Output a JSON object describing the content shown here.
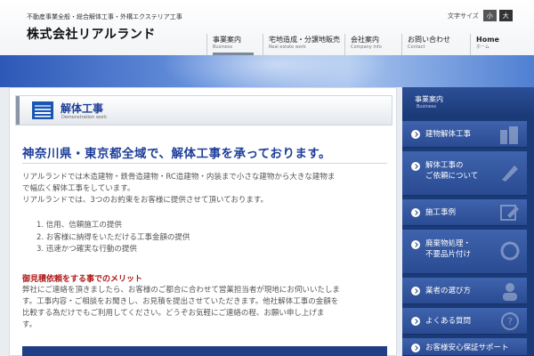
{
  "header": {
    "tagline": "不動産事業全般・総合解体工事・外構エクステリア工事",
    "logo": "株式会社リアルランド",
    "font_size": {
      "label": "文字サイズ",
      "small": "小",
      "large": "大"
    }
  },
  "nav": [
    {
      "jp": "事業案内",
      "en": "Business"
    },
    {
      "jp": "宅地造成・分譲地販売",
      "en": "Real estate work"
    },
    {
      "jp": "会社案内",
      "en": "Company info"
    },
    {
      "jp": "お問い合わせ",
      "en": "Contact"
    },
    {
      "jp": "Home",
      "en": "ホーム"
    }
  ],
  "main": {
    "title": "解体工事",
    "title_sub": "Demonstration work",
    "headline": "神奈川県・東京都全域で、解体工事を承っております。",
    "intro": [
      "リアルランドでは木造建物・鉄骨造建物・RC造建物・内装まで小さな建物から大きな建物ま",
      "で幅広く解体工事をしています。",
      "リアルランドでは、3つのお約束をお客様に提供させて頂いております。"
    ],
    "promises": [
      "1. 信用、信頼施工の提供",
      "2. お客様に納得をいただける工事金額の提供",
      "3. 迅速かつ確実な行動の提供"
    ],
    "merit_title": "御見積依頼をする事でのメリット",
    "merit_body": [
      "弊社にご連絡を頂きましたら、お客様のご都合に合わせて営業担当者が現地にお伺いいたしま",
      "す。工事内容・ご相談をお聞きし、お見積を提出させていただきます。他社解体工事の金額を",
      "比較する為だけでもご利用してください。どうぞお気軽にご連絡の程、お願い申し上げま",
      "す。"
    ]
  },
  "sidebar": {
    "head_jp": "事業案内",
    "head_en": "Business",
    "items": [
      {
        "lines": [
          "建物解体工事"
        ]
      },
      {
        "lines": [
          "解体工事の",
          "ご依頼について"
        ]
      },
      {
        "lines": [
          "施工事例"
        ]
      },
      {
        "lines": [
          "廃棄物処理・",
          "不要品片付け"
        ]
      },
      {
        "lines": [
          "業者の選び方"
        ]
      },
      {
        "lines": [
          "よくある質問"
        ]
      },
      {
        "lines": [
          "お客様安心保証サポート"
        ]
      }
    ]
  },
  "colors": {
    "accent_blue": "#1e3f9a",
    "sidebar_navy": "#1b3a78",
    "merit_red": "#b01818"
  }
}
